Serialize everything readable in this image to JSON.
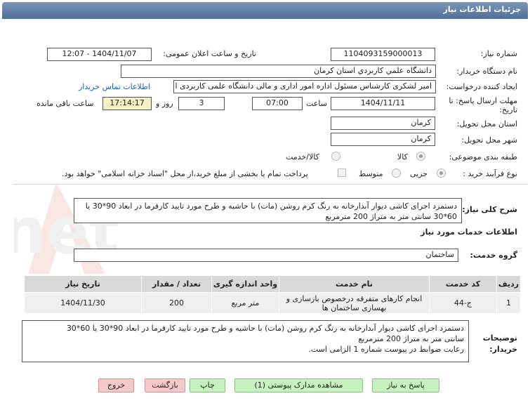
{
  "header": {
    "title": "جزئیات اطلاعات نیاز"
  },
  "fields": {
    "need_number_label": "شماره نیاز:",
    "need_number": "1104093159000013",
    "announce_label": "تاریخ و ساعت اعلان عمومی:",
    "announce_value": "1404/11/07 - 12:07",
    "buyer_org_label": "نام دستگاه خریدار:",
    "buyer_org": "دانشگاه علمي كاربردي استان كرمان",
    "creator_label": "ایجاد کننده درخواست:",
    "creator": "امیر لشکری کارشناس مسئول اداره امور اداری و مالی دانشگاه علمی کاربردی ا",
    "contact_link": "اطلاعات تماس خریدار",
    "deadline_label": "مهلت ارسال پاسخ: تا تاریخ:",
    "deadline_date": "1404/11/11",
    "time_label": "ساعت",
    "deadline_time": "07:00",
    "days_count": "3",
    "days_label": "روز و",
    "remaining_time": "17:14:17",
    "remaining_label": "ساعت باقی مانده",
    "province_label": "استان محل تحویل:",
    "province": "کرمان",
    "city_label": "شهر محل تحویل:",
    "city": "کرمان",
    "category_label": "طبقه بندی موضوعی:",
    "category_options": [
      "کالا",
      "کالا/خدمت"
    ],
    "category_selected": "کالا",
    "process_label": "نوع فرآیند خرید :",
    "process_options": [
      "جزیی",
      "متوسط"
    ],
    "process_selected": "جزیی",
    "treasury_note": "پرداخت تمام یا بخشی از مبلغ خرید،از محل \"اسناد خزانه اسلامی\" خواهد بود."
  },
  "description": {
    "label": "شرح کلی نیاز:",
    "text": "دستمزد اجرای کاشی دیوار آبدارخانه به رنگ کرم روشن (مات) با حاشیه و طرح مورد تایید کارفرما در ابعاد 90*30 یا 60*30 سانتی متر به متراژ 200 مترمربع"
  },
  "services": {
    "section_title": "اطلاعات خدمات مورد نیاز",
    "group_label": "گروه خدمت:",
    "group_value": "ساختمان",
    "columns": [
      "ردیف",
      "کد خدمت",
      "نام خدمت",
      "واحد اندازه گیری",
      "تعداد / مقدار",
      "تاریخ نیاز"
    ],
    "rows": [
      [
        "1",
        "ج-44",
        "انجام کارهای متفرقه درخصوص بازسازی و بهسازی ساختمان ها",
        "متر مربع",
        "200",
        "1404/11/30"
      ]
    ]
  },
  "buyer_notes": {
    "label": "توضیحات خریدار:",
    "line1": "دستمزد اجرای کاشی دیوار آبدارخانه به رنگ کرم روشن (مات) با حاشیه و طرح مورد تایید کارفرما در ابعاد 90*30 یا 60*30",
    "line2": "سانتی متر به متراژ 200 مترمربع",
    "line3": "رعایت ضوابط در پیوست شماره 1 الزامی است."
  },
  "buttons": {
    "reply": "پاسخ به نیاز",
    "attachments": "مشاهده مدارک پیوستی (1)",
    "print": "چاپ",
    "back": "بازگشت",
    "exit": "خروج"
  },
  "watermark_text": "AriaTender.net"
}
